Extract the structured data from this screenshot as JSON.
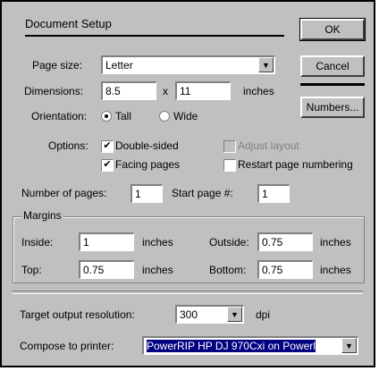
{
  "dialog": {
    "title": "Document Setup",
    "ok_label": "OK",
    "cancel_label": "Cancel",
    "numbers_label": "Numbers..."
  },
  "page_size": {
    "label": "Page size:",
    "value": "Letter"
  },
  "dimensions": {
    "label": "Dimensions:",
    "width": "8.5",
    "x": "x",
    "height": "11",
    "unit": "inches"
  },
  "orientation": {
    "label": "Orientation:",
    "tall": "Tall",
    "wide": "Wide",
    "selected": "Tall"
  },
  "options": {
    "label": "Options:",
    "double_sided": "Double-sided",
    "facing_pages": "Facing pages",
    "adjust_layout": "Adjust layout",
    "restart_numbering": "Restart page numbering"
  },
  "pages": {
    "number_label": "Number of pages:",
    "number_value": "1",
    "start_label": "Start page #:",
    "start_value": "1"
  },
  "margins": {
    "label": "Margins",
    "inside_label": "Inside:",
    "inside_value": "1",
    "outside_label": "Outside:",
    "outside_value": "0.75",
    "top_label": "Top:",
    "top_value": "0.75",
    "bottom_label": "Bottom:",
    "bottom_value": "0.75",
    "unit": "inches"
  },
  "resolution": {
    "label": "Target output resolution:",
    "value": "300",
    "unit": "dpi"
  },
  "printer": {
    "label": "Compose to printer:",
    "value": "PowerRIP HP DJ 970Cxi on Powerl"
  },
  "icons": {
    "dropdown": "chevron-down-icon"
  }
}
